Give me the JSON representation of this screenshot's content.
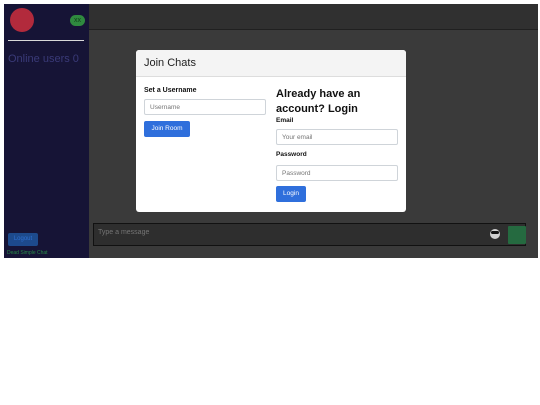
{
  "sidebar": {
    "user_badge": "xx",
    "online_users": "Online users 0",
    "logout_label": "Logout",
    "footer": "Dead Simple Chat"
  },
  "message_bar": {
    "placeholder": "Type a message"
  },
  "modal": {
    "title": "Join Chats",
    "left": {
      "heading": "Set a Username",
      "username_placeholder": "Username",
      "join_label": "Join Room"
    },
    "right": {
      "heading": "Already have an account? Login",
      "email_label": "Email",
      "email_placeholder": "Your email",
      "password_label": "Password",
      "password_placeholder": "Password",
      "login_label": "Login"
    }
  }
}
